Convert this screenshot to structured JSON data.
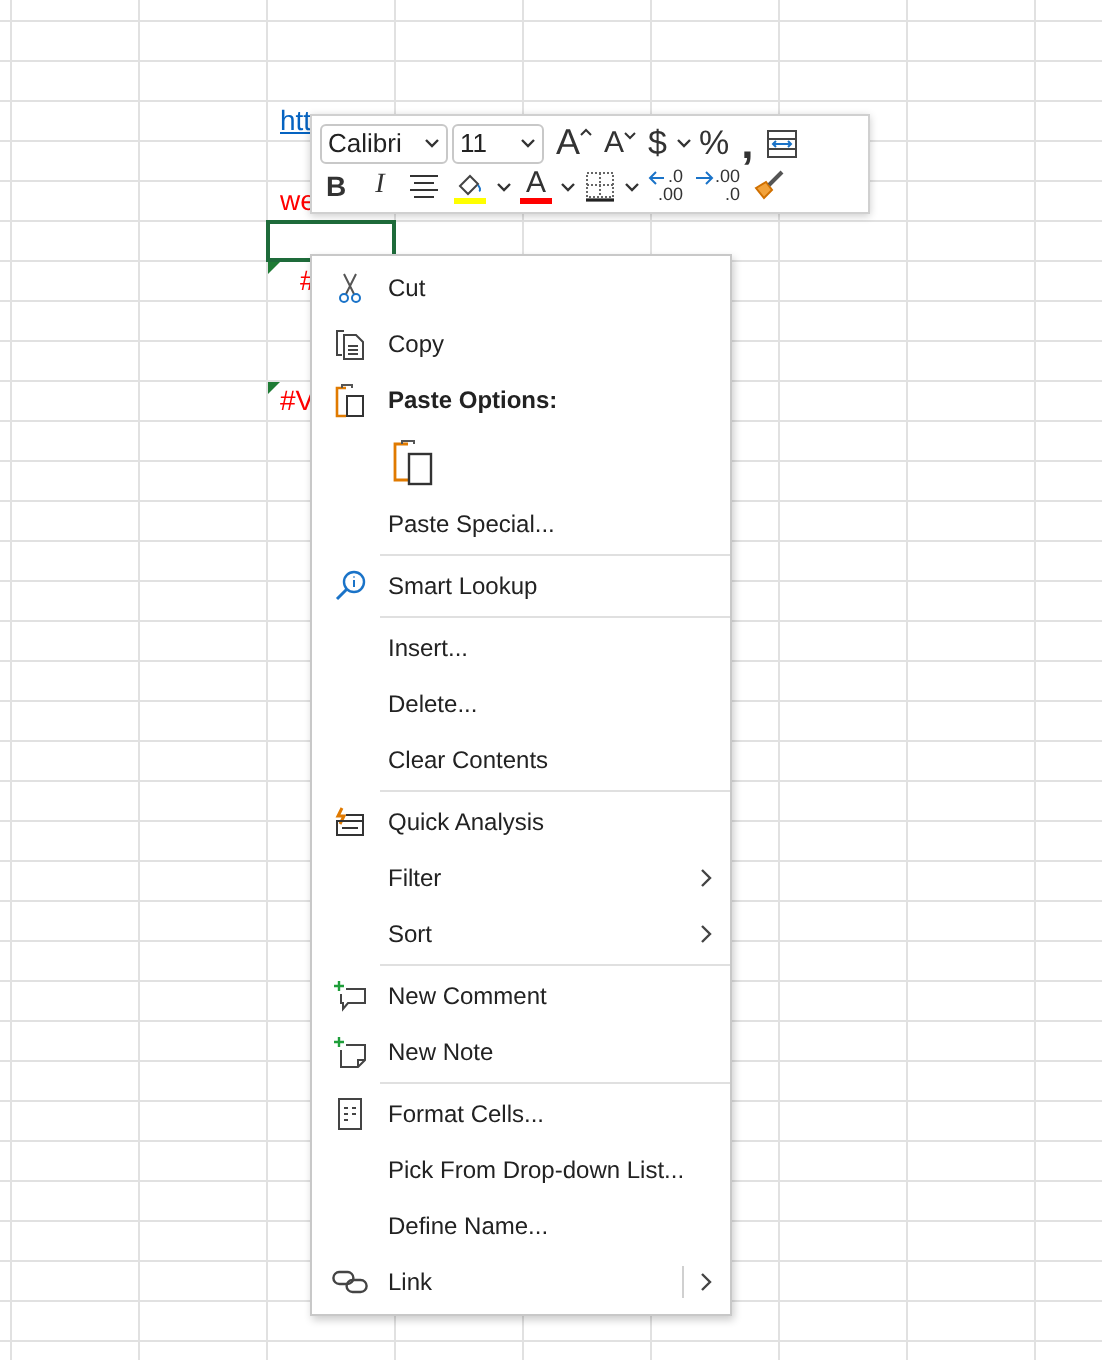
{
  "cells": [
    {
      "kind": "link",
      "text": "htt",
      "flagged": false,
      "selected": false
    },
    {
      "kind": "error",
      "text": "we",
      "flagged": false,
      "selected": false
    },
    {
      "kind": "empty",
      "flagged": false,
      "selected": true
    },
    {
      "kind": "error",
      "text": "#",
      "flagged": true,
      "selected": false
    },
    {
      "kind": "error",
      "text": "#V",
      "flagged": true,
      "selected": false
    }
  ],
  "mini_toolbar": {
    "font_row": [
      {
        "kind": "font",
        "value": "Calibri"
      },
      {
        "kind": "size",
        "value": "11"
      },
      {
        "kind": "grow",
        "label": "A"
      },
      {
        "kind": "shrink",
        "label": "A"
      },
      {
        "kind": "text",
        "label": "$"
      },
      {
        "kind": "caret"
      },
      {
        "kind": "text",
        "label": "%"
      },
      {
        "kind": "comma",
        "label": ","
      },
      {
        "kind": "merge"
      }
    ],
    "format_row": [
      {
        "kind": "bold",
        "label": "B"
      },
      {
        "kind": "italic",
        "label": "I"
      },
      {
        "kind": "align"
      },
      {
        "kind": "fill",
        "color": "#ffff00"
      },
      {
        "kind": "caret"
      },
      {
        "kind": "fontcolor",
        "label": "A",
        "color": "#ff0000"
      },
      {
        "kind": "caret"
      },
      {
        "kind": "borders"
      },
      {
        "kind": "caret"
      },
      {
        "kind": "decrease",
        "top": ".0",
        "bottom": ".00"
      },
      {
        "kind": "increase",
        "top": ".00",
        "bottom": ".0"
      },
      {
        "kind": "painter"
      }
    ]
  },
  "context_menu": {
    "groups": [
      [
        {
          "kind": "item",
          "label": "Cut"
        },
        {
          "kind": "item",
          "label": "Copy"
        },
        {
          "kind": "heading",
          "label": "Paste Options:"
        },
        {
          "kind": "paste-icons"
        },
        {
          "kind": "item",
          "label": "Paste Special..."
        }
      ],
      [
        {
          "kind": "item",
          "label": "Smart Lookup"
        }
      ],
      [
        {
          "kind": "item",
          "label": "Insert..."
        },
        {
          "kind": "item",
          "label": "Delete..."
        },
        {
          "kind": "item",
          "label": "Clear Contents"
        }
      ],
      [
        {
          "kind": "item",
          "label": "Quick Analysis"
        },
        {
          "kind": "submenu",
          "label": "Filter"
        },
        {
          "kind": "submenu",
          "label": "Sort"
        }
      ],
      [
        {
          "kind": "item",
          "label": "New Comment"
        },
        {
          "kind": "item",
          "label": "New Note"
        }
      ],
      [
        {
          "kind": "item",
          "label": "Format Cells..."
        },
        {
          "kind": "item",
          "label": "Pick From Drop-down List..."
        },
        {
          "kind": "item",
          "label": "Define Name..."
        },
        {
          "kind": "split",
          "label": "Link"
        }
      ]
    ]
  }
}
